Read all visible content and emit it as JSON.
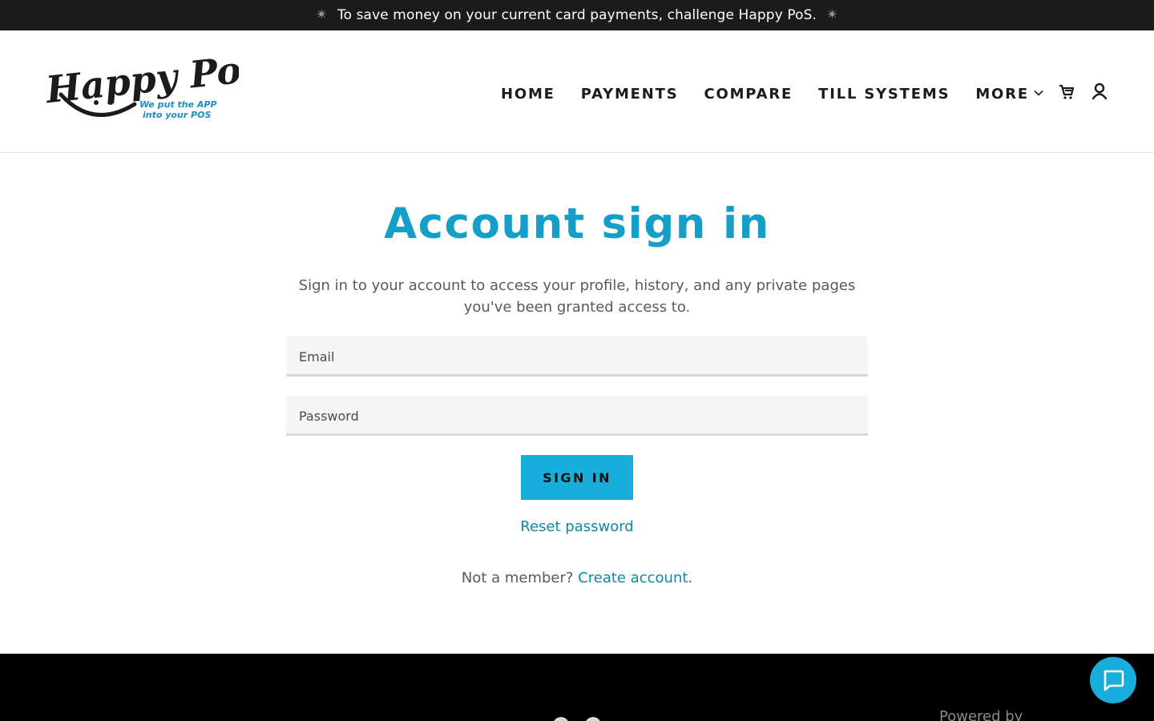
{
  "announcement": {
    "text": "To save money on your current card payments, challenge Happy PoS.",
    "left_icon": "sparkle-icon",
    "right_icon": "sparkle-icon"
  },
  "header": {
    "logo": {
      "wordmark": "Happy PoS",
      "tagline_line1": "We put the APP",
      "tagline_line2": "into your POS"
    },
    "nav": [
      {
        "label": "HOME"
      },
      {
        "label": "PAYMENTS"
      },
      {
        "label": "COMPARE"
      },
      {
        "label": "TILL SYSTEMS"
      },
      {
        "label": "MORE"
      }
    ],
    "icons": [
      "cart-icon",
      "user-icon",
      "chevron-down-icon"
    ]
  },
  "main": {
    "title": "Account sign in",
    "subtitle": "Sign in to your account to access your profile, history, and any private pages you've been granted access to.",
    "email_placeholder": "Email",
    "email_value": "",
    "password_placeholder": "Password",
    "password_value": "",
    "signin_label": "SIGN IN",
    "reset_label": "Reset password",
    "not_member": "Not a member?",
    "create_account": "Create account."
  },
  "footer": {
    "powered_by": "Powered by"
  },
  "chat": {
    "icon": "chat-icon"
  },
  "colors": {
    "accent": "#159ec7",
    "button": "#18aedc",
    "link": "#0e87a8",
    "banner": "#1b1b1b",
    "footer": "#000000"
  }
}
